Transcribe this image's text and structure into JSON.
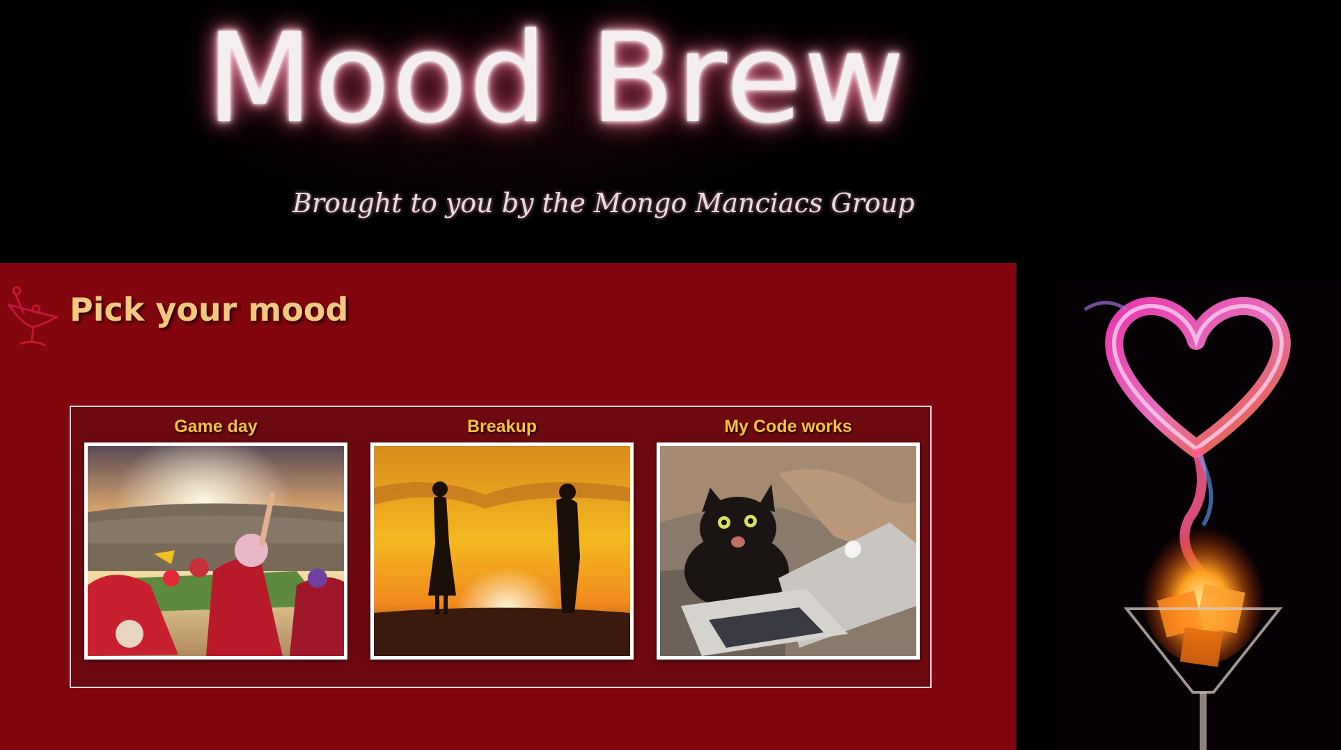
{
  "header": {
    "title": "Mood Brew",
    "subtitle": "Brought to you by the Mongo Manciacs Group"
  },
  "main": {
    "section_title": "Pick your mood",
    "icon": "cocktail-glass-icon",
    "moods": [
      {
        "label": "Game day",
        "image": "stadium-fans-photo"
      },
      {
        "label": "Breakup",
        "image": "sunset-couple-silhouette-photo"
      },
      {
        "label": "My Code works",
        "image": "cat-with-laptop-photo"
      }
    ]
  },
  "side": {
    "image": "fiery-heart-cocktail-photo"
  },
  "colors": {
    "background": "#000000",
    "panel": "#82060d",
    "section_title": "#f2c77f",
    "mood_label": "#f5bf40",
    "title_glow": "#e06a88"
  }
}
